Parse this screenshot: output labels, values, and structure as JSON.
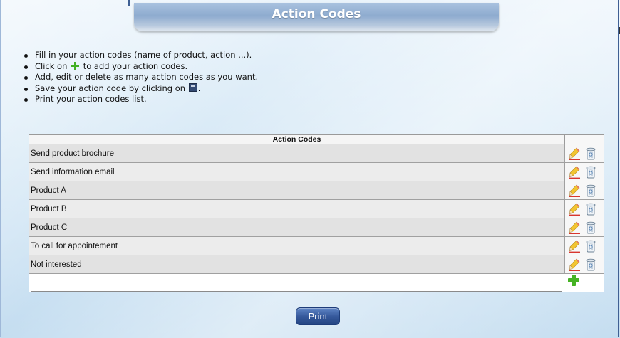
{
  "header": {
    "title": "Action Codes"
  },
  "instructions": [
    {
      "before": "Fill in your action codes (name of product, action ...).",
      "icon": "",
      "after": ""
    },
    {
      "before": "Click on",
      "icon": "plus-icon",
      "after": "to add your action codes."
    },
    {
      "before": "Add, edit or delete as many action codes as you want.",
      "icon": "",
      "after": ""
    },
    {
      "before": "Save your action code by clicking on",
      "icon": "save-disk-icon",
      "after": "."
    },
    {
      "before": "Print your action codes list.",
      "icon": "",
      "after": ""
    }
  ],
  "table": {
    "header": "Action Codes",
    "rows": [
      {
        "name": "Send product brochure"
      },
      {
        "name": "Send information email"
      },
      {
        "name": "Product A"
      },
      {
        "name": "Product B"
      },
      {
        "name": "Product C"
      },
      {
        "name": "To call for appointement"
      },
      {
        "name": "Not interested"
      }
    ],
    "new_value": ""
  },
  "print_label": "Print",
  "colors": {
    "accent_blue": "#36599c",
    "add_green": "#46b324",
    "title_tab": "#8eabcf"
  }
}
